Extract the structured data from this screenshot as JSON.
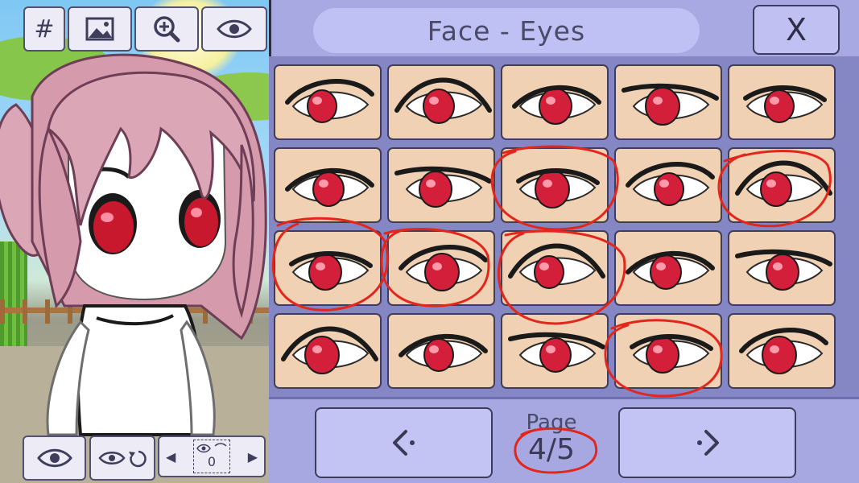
{
  "header": {
    "title": "Face - Eyes",
    "close_label": "X"
  },
  "left_toolbar": {
    "items": [
      {
        "name": "grid-button",
        "label": "#"
      },
      {
        "name": "background-image-button",
        "icon": "image-icon"
      },
      {
        "name": "zoom-button",
        "icon": "zoom-in-icon"
      },
      {
        "name": "visibility-button",
        "icon": "eye-icon"
      }
    ]
  },
  "bottom_controls": {
    "layer_value": "0"
  },
  "eye_grid": {
    "rows": 4,
    "columns": 5,
    "iris_color": "#d41f3a",
    "skin_color": "#f0d1b3",
    "annotated_cells": [
      7,
      9,
      10,
      11,
      12,
      18
    ]
  },
  "pagination": {
    "label": "Page",
    "value": "4/5",
    "current": 4,
    "total": 5
  },
  "colors": {
    "panel": "#a8a9e3",
    "button": "#c3c4f4",
    "annotation": "#e3261c"
  }
}
